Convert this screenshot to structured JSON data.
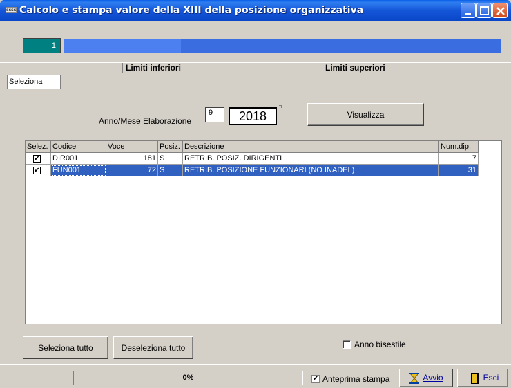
{
  "window": {
    "title": "Calcolo e stampa valore della XIII della posizione organizzativa",
    "icon_text": "ssss"
  },
  "progress": {
    "counter_value": "1"
  },
  "limits": {
    "lower": "Limiti inferiori",
    "upper": "Limiti superiori"
  },
  "tabs": [
    "Seleziona"
  ],
  "filter": {
    "label": "Anno/Mese Elaborazione",
    "month": "9",
    "year": "2018",
    "view_button": "Visualizza"
  },
  "table": {
    "columns": [
      "Selez.",
      "Codice",
      "Voce",
      "Posiz.",
      "Descrizione",
      "Num.dip."
    ],
    "rows": [
      {
        "checked": "✔",
        "codice": "DIR001",
        "voce": "181",
        "posiz": "S",
        "descrizione": "RETRIB. POSIZ. DIRIGENTI",
        "num_dip": "7",
        "selected": false
      },
      {
        "checked": "✔",
        "codice": "FUN001",
        "voce": "72",
        "posiz": "S",
        "descrizione": "RETRIB. POSIZIONE FUNZIONARI (NO INADEL)",
        "num_dip": "31",
        "selected": true
      }
    ]
  },
  "actions": {
    "select_all": "Seleziona tutto",
    "deselect_all": "Deseleziona tutto",
    "leap_year_label": "Anno bisestile",
    "leap_year_checked": false
  },
  "status": {
    "percent": "0%",
    "preview_label": "Anteprima stampa",
    "preview_checked": "✔",
    "start_button": "Avvio",
    "exit_button": "Esci"
  },
  "colors": {
    "titlebar": "#0a46c8",
    "selection": "#3060c0",
    "counter_bg": "#008080",
    "progress_fill": "#3a6ee0"
  }
}
